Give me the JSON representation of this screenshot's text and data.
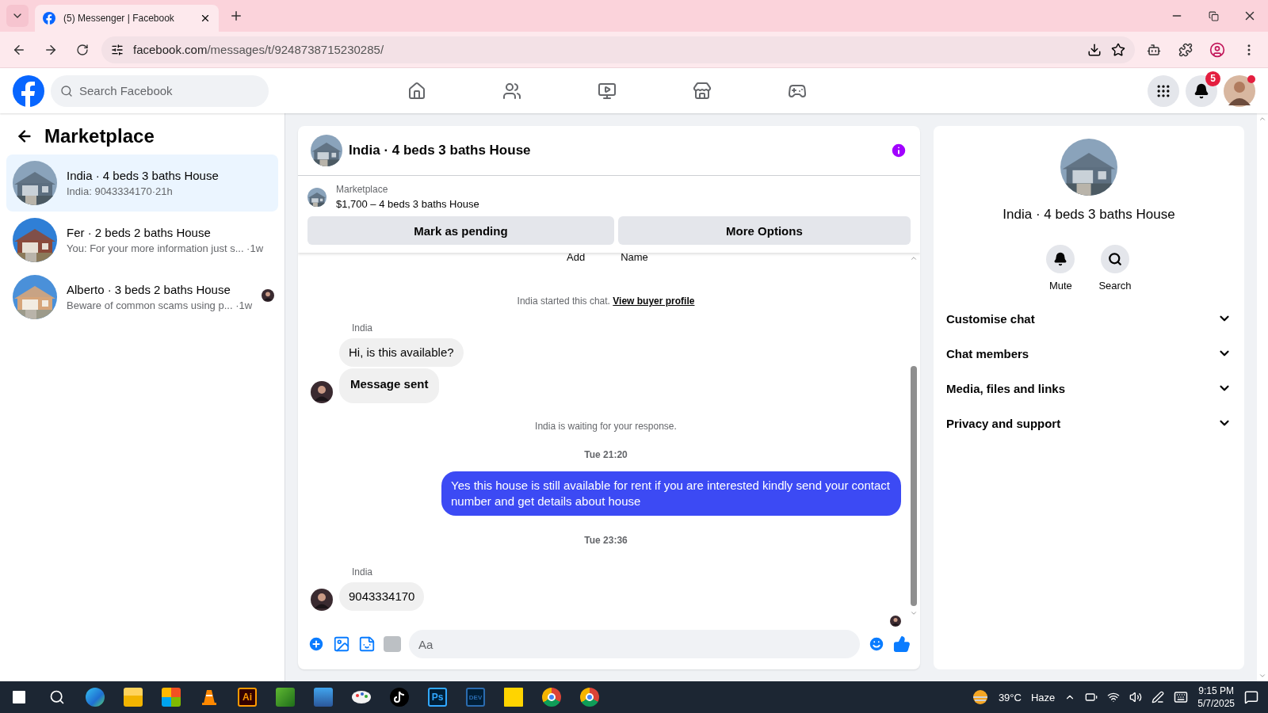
{
  "browser": {
    "tab_title": "(5) Messenger | Facebook",
    "url_host": "facebook.com",
    "url_path": "/messages/t/9248738715230285/"
  },
  "topbar": {
    "search_placeholder": "Search Facebook",
    "notification_count": "5"
  },
  "sidebar": {
    "title": "Marketplace",
    "conversations": [
      {
        "title": "India · 4 beds 3 baths House",
        "preview": "India: 9043334170·21h",
        "selected": true,
        "seen": false
      },
      {
        "title": "Fer · 2 beds 2 baths House",
        "preview": "You: For your more information just s... ·1w",
        "selected": false,
        "seen": false
      },
      {
        "title": "Alberto · 3 beds 2 baths House",
        "preview": "Beware of common scams using p... ·1w",
        "selected": false,
        "seen": true
      }
    ]
  },
  "chat": {
    "title": "India · 4 beds 3 baths House",
    "listing_source": "Marketplace",
    "listing": "$1,700 – 4 beds 3 baths House",
    "buttons": [
      "Mark as pending",
      "More Options"
    ],
    "cut_labels": [
      "Add",
      "Name"
    ],
    "messages": [
      {
        "kind": "notice",
        "text": "India started this chat.",
        "link": "View buyer profile"
      },
      {
        "kind": "incoming",
        "sender": "India",
        "bubbles": [
          {
            "kind": "text",
            "text": "Hi, is this available?"
          },
          {
            "kind": "status",
            "text": "Message sent"
          }
        ]
      },
      {
        "kind": "notice",
        "text": "India is waiting for your response."
      },
      {
        "kind": "timestamp",
        "text": "Tue 21:20"
      },
      {
        "kind": "outgoing",
        "bubbles": [
          {
            "kind": "text",
            "text": "Yes this house is still available for rent if you are interested kindly send your contact number and get details about house"
          }
        ]
      },
      {
        "kind": "timestamp",
        "text": "Tue 23:36"
      },
      {
        "kind": "incoming",
        "sender": "India",
        "bubbles": [
          {
            "kind": "text",
            "text": "9043334170"
          }
        ]
      }
    ],
    "composer_placeholder": "Aa"
  },
  "details": {
    "title": "India · 4 beds 3 baths House",
    "actions": [
      {
        "kind": "bell",
        "label": "Mute"
      },
      {
        "kind": "search",
        "label": "Search"
      }
    ],
    "sections": [
      {
        "label": "Customise chat",
        "expanded": false
      },
      {
        "label": "Chat members",
        "expanded": false
      },
      {
        "label": "Media, files and links",
        "expanded": false
      },
      {
        "label": "Privacy and support",
        "expanded": false
      }
    ]
  },
  "taskbar": {
    "apps": [
      {
        "kind": "edge"
      },
      {
        "kind": "folder"
      },
      {
        "kind": "store"
      },
      {
        "kind": "vlc"
      },
      {
        "kind": "badge",
        "label": "Ai",
        "color": "#ff9a00"
      },
      {
        "kind": "leaf"
      },
      {
        "kind": "word"
      },
      {
        "kind": "paint"
      },
      {
        "kind": "tiktok"
      },
      {
        "kind": "badge",
        "label": "Ps",
        "color": "#31a8ff"
      },
      {
        "kind": "badge",
        "label": "DEV",
        "color": "#2b6cb0"
      },
      {
        "kind": "note"
      },
      {
        "kind": "chrome"
      },
      {
        "kind": "chrome"
      }
    ],
    "temperature": "39°C",
    "weather": "Haze",
    "time": "9:15 PM",
    "date": "5/7/2025"
  }
}
